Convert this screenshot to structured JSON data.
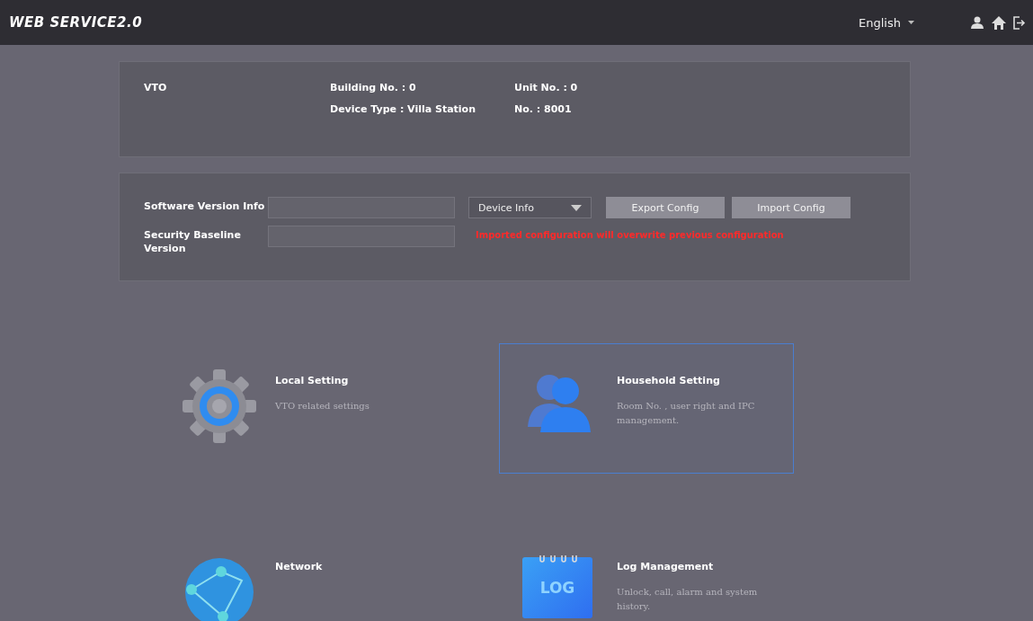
{
  "header": {
    "logo": "WEB SERVICE2.0",
    "language": "English"
  },
  "device": {
    "name": "VTO",
    "fields": [
      {
        "label": "Building No. : 0"
      },
      {
        "label": "Unit No. : 0"
      },
      {
        "label": "Device Type : Villa Station"
      },
      {
        "label": "No. : 8001"
      }
    ]
  },
  "config": {
    "software_version_label": "Software Version Info",
    "security_baseline_label": "Security Baseline Version",
    "dropdown": "Device Info",
    "buttons": [
      "Export Config",
      "Import Config"
    ],
    "warning": "Imported configuration will overwrite previous configuration"
  },
  "tiles": [
    {
      "kind": "gear",
      "title": "Local Setting",
      "description": "VTO related settings",
      "selected": false
    },
    {
      "kind": "users",
      "title": "Household Setting",
      "description": "Room No. , user right and IPC management.",
      "selected": true
    },
    {
      "kind": "globe",
      "title": "Network",
      "selected": false
    },
    {
      "kind": "log",
      "title": "Log Management",
      "description": "Unlock, call, alarm and system history.",
      "icon_label": "LOG",
      "selected": false
    }
  ]
}
